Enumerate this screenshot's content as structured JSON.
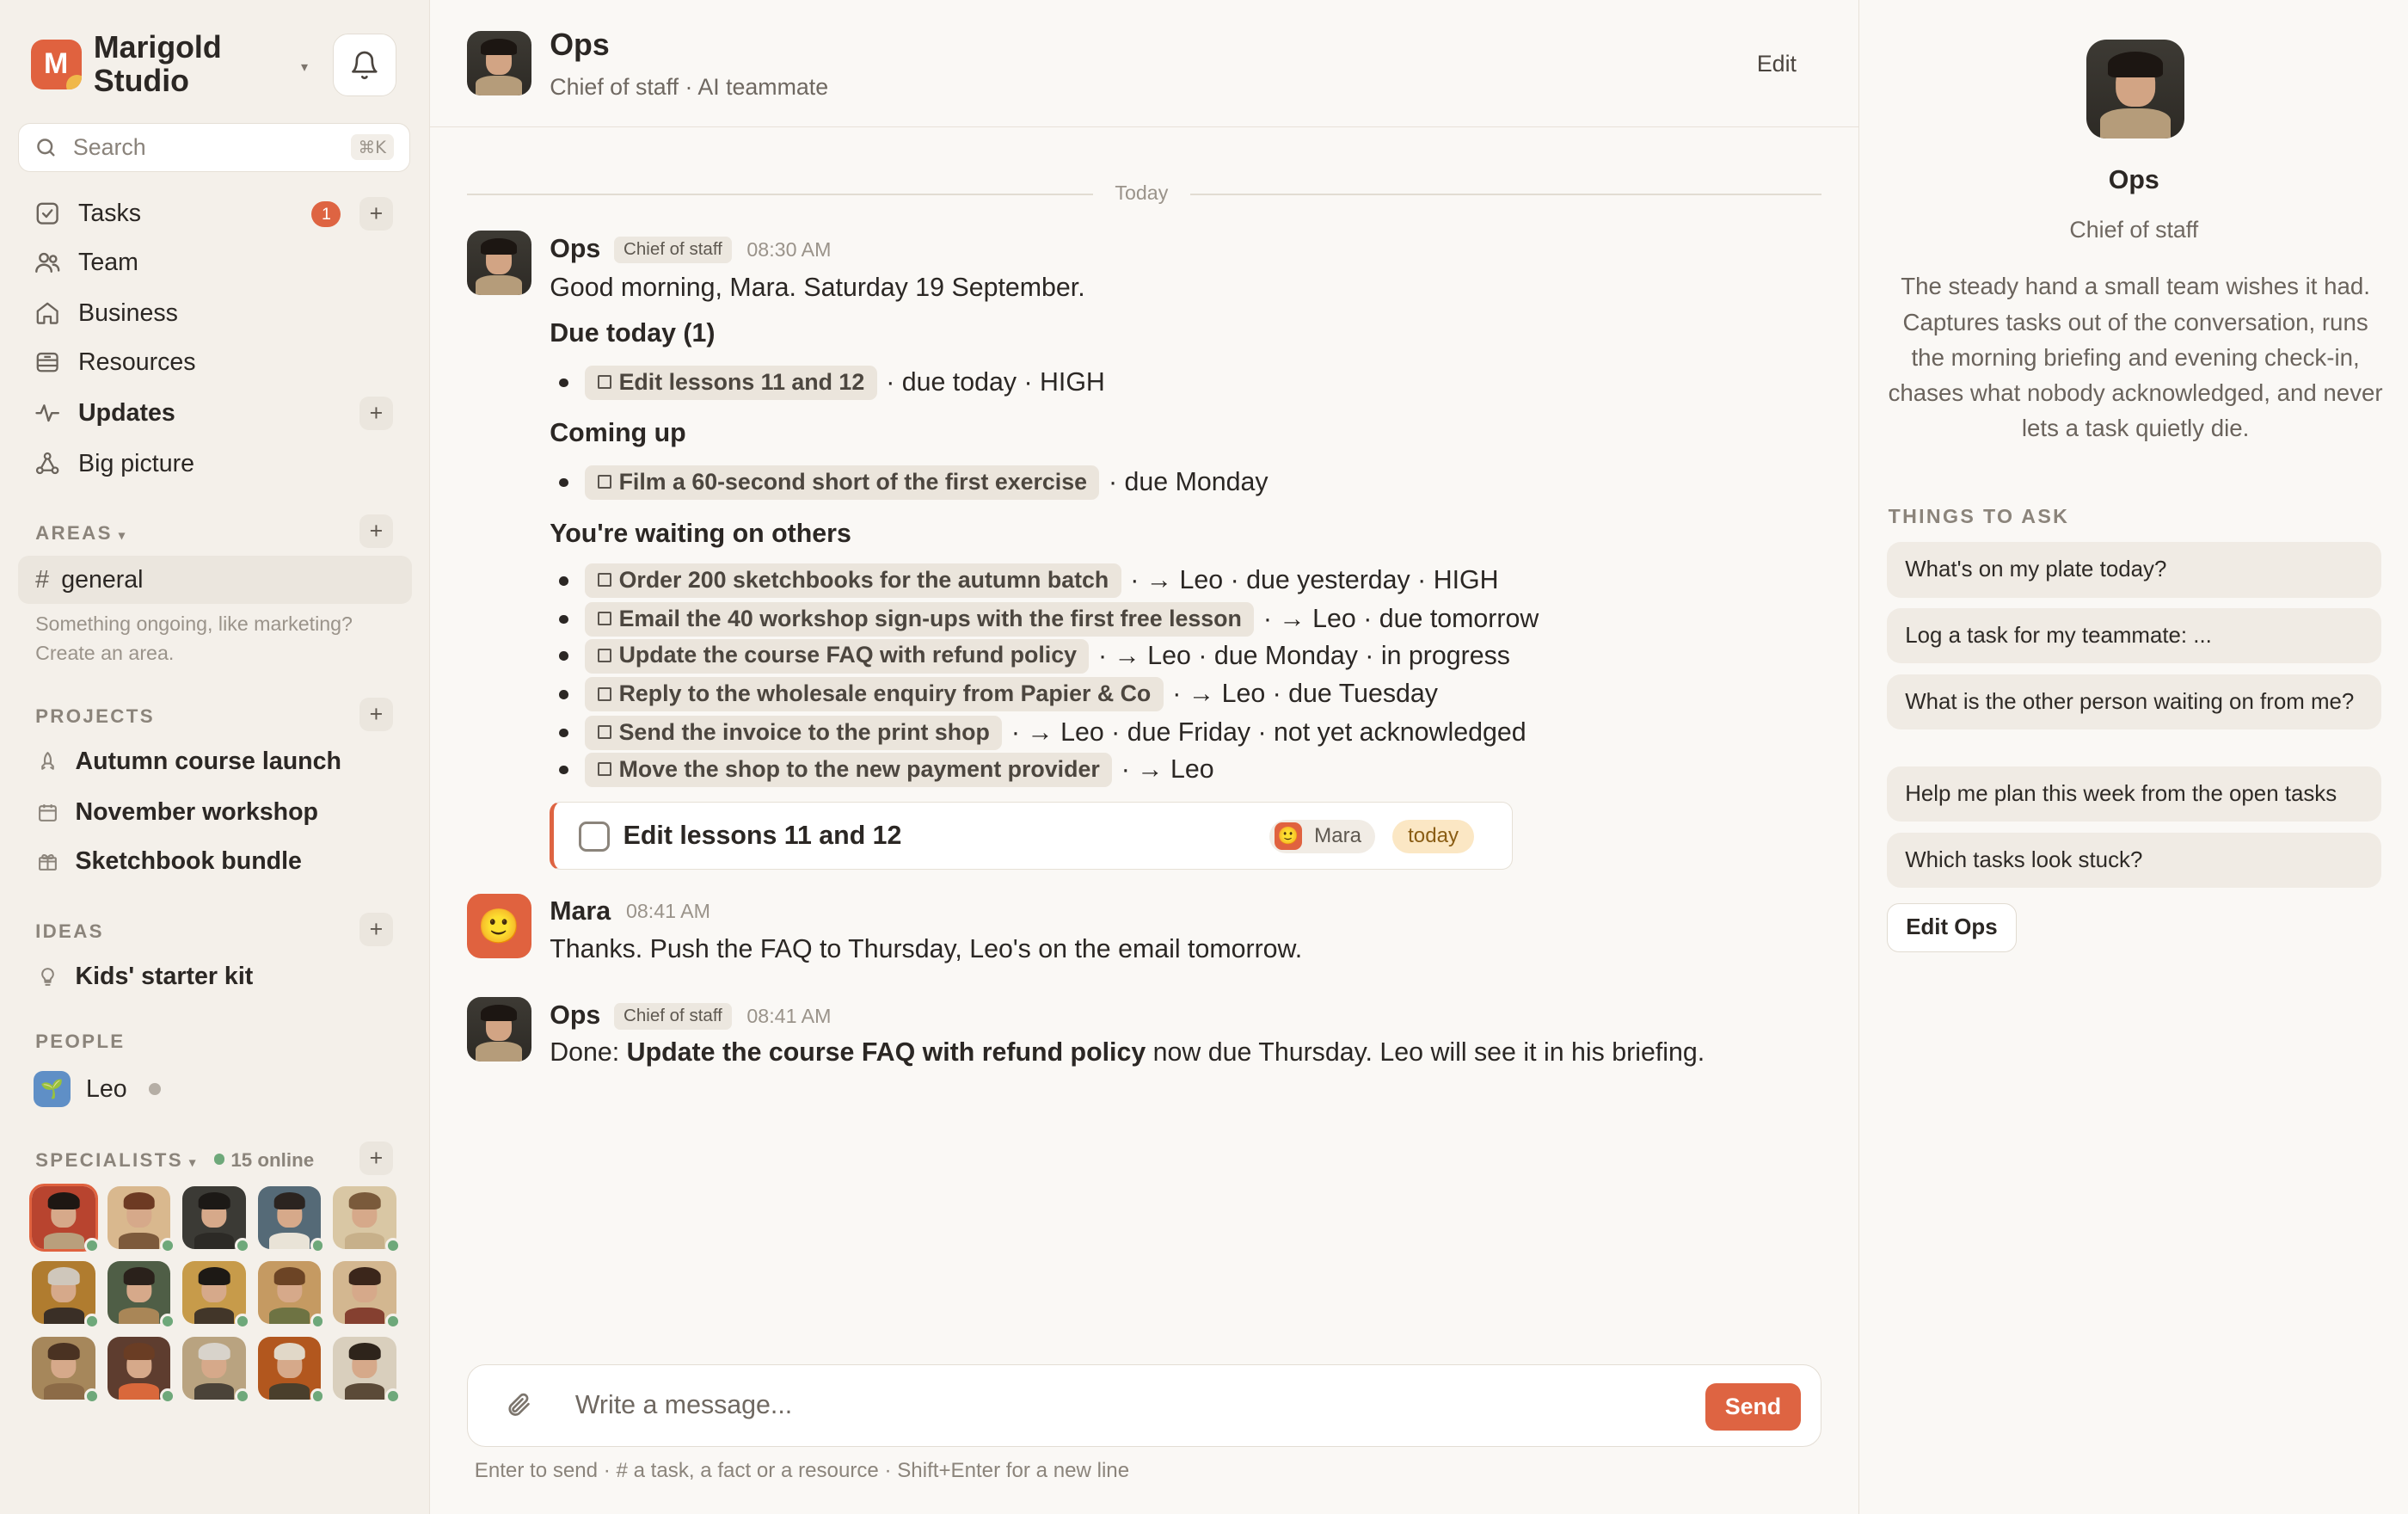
{
  "workspace": {
    "name": "Marigold Studio",
    "logo_letter": "M",
    "caret": "▾"
  },
  "search": {
    "placeholder": "Search",
    "shortcut": "⌘K"
  },
  "nav": [
    {
      "label": "Tasks",
      "icon": "checkbox-icon",
      "badge": "1",
      "plus": true
    },
    {
      "label": "Team",
      "icon": "team-icon"
    },
    {
      "label": "Business",
      "icon": "home-icon"
    },
    {
      "label": "Resources",
      "icon": "archive-icon"
    },
    {
      "label": "Updates",
      "icon": "activity-icon",
      "plus": true,
      "bold": true
    },
    {
      "label": "Big picture",
      "icon": "nodes-icon"
    }
  ],
  "areas": {
    "title": "AREAS",
    "items": [
      {
        "label": "general",
        "prefix": "#"
      }
    ],
    "hint": "Something ongoing, like marketing? Create an area."
  },
  "projects": {
    "title": "PROJECTS",
    "items": [
      {
        "label": "Autumn course launch",
        "icon": "rocket-icon"
      },
      {
        "label": "November workshop",
        "icon": "calendar-icon"
      },
      {
        "label": "Sketchbook bundle",
        "icon": "gift-icon"
      }
    ]
  },
  "ideas": {
    "title": "IDEAS",
    "items": [
      {
        "label": "Kids' starter kit",
        "icon": "lightbulb-icon"
      }
    ]
  },
  "people": {
    "title": "PEOPLE",
    "items": [
      {
        "label": "Leo",
        "avatar": "🌱"
      }
    ]
  },
  "specialists": {
    "title": "SPECIALISTS",
    "online": "15 online",
    "avatars": [
      {
        "bg": "#b8442f",
        "hair": "#1e1713",
        "shirt": "#b99f7c",
        "selected": true
      },
      {
        "bg": "#d9b88e",
        "hair": "#6d3a23",
        "shirt": "#7d5a3c"
      },
      {
        "bg": "#3b3a35",
        "hair": "#1c1916",
        "shirt": "#2c2a26"
      },
      {
        "bg": "#556a77",
        "hair": "#2b2420",
        "shirt": "#e9e3d7"
      },
      {
        "bg": "#d9c7a4",
        "hair": "#7a5a3b",
        "shirt": "#c7b08a"
      },
      {
        "bg": "#b07c2f",
        "hair": "#cfc7bb",
        "shirt": "#3a2f26"
      },
      {
        "bg": "#4f5e46",
        "hair": "#2a211b",
        "shirt": "#a98657"
      },
      {
        "bg": "#c79b4a",
        "hair": "#1d1915",
        "shirt": "#423629"
      },
      {
        "bg": "#c59a62",
        "hair": "#6c4425",
        "shirt": "#6e7343"
      },
      {
        "bg": "#d3b790",
        "hair": "#3b261b",
        "shirt": "#854030"
      },
      {
        "bg": "#a6875b",
        "hair": "#4a3222",
        "shirt": "#8c6b47"
      },
      {
        "bg": "#5e3d2f",
        "hair": "#6a3d24",
        "shirt": "#d9683b"
      },
      {
        "bg": "#b9a380",
        "hair": "#d8d3cb",
        "shirt": "#4b4339"
      },
      {
        "bg": "#b2571e",
        "hair": "#e1d8c8",
        "shirt": "#4a3f2c"
      },
      {
        "bg": "#d9cfbd",
        "hair": "#2e241b",
        "shirt": "#5b4a38"
      }
    ]
  },
  "header": {
    "name": "Ops",
    "subtitle": "Chief of staff · AI teammate",
    "edit": "Edit"
  },
  "thread": {
    "day": "Today",
    "msg1": {
      "name": "Ops",
      "role": "Chief of staff",
      "time": "08:30 AM",
      "greeting": "Good morning, Mara. Saturday 19 September.",
      "due_today_title": "Due today (1)",
      "due_today": [
        {
          "task": "Edit lessons 11 and 12",
          "after": "· due today · HIGH"
        }
      ],
      "coming_up_title": "Coming up",
      "coming_up": [
        {
          "task": "Film a 60-second short of the first exercise",
          "after": "· due Monday"
        }
      ],
      "waiting_title": "You're waiting on others",
      "waiting": [
        {
          "task": "Order 200 sketchbooks for the autumn batch",
          "after": "· → Leo · due yesterday · HIGH"
        },
        {
          "task": "Email the 40 workshop sign-ups with the first free lesson",
          "after": "· → Leo · due tomorrow"
        },
        {
          "task": "Update the course FAQ with refund policy",
          "after": "· → Leo · due Monday · in progress"
        },
        {
          "task": "Reply to the wholesale enquiry from Papier & Co",
          "after": "· → Leo · due Tuesday"
        },
        {
          "task": "Send the invoice to the print shop",
          "after": "· → Leo · due Friday · not yet acknowledged"
        },
        {
          "task": "Move the shop to the new payment provider",
          "after": "· → Leo"
        }
      ],
      "card": {
        "title": "Edit lessons 11 and 12",
        "assignee": "Mara",
        "due": "today"
      }
    },
    "msg2": {
      "name": "Mara",
      "time": "08:41 AM",
      "text": "Thanks. Push the FAQ to Thursday, Leo's on the email tomorrow."
    },
    "msg3": {
      "name": "Ops",
      "role": "Chief of staff",
      "time": "08:41 AM",
      "prefix": "Done: ",
      "bold": "Update the course FAQ with refund policy",
      "suffix": " now due Thursday. Leo will see it in his briefing."
    }
  },
  "composer": {
    "placeholder": "Write a message...",
    "send": "Send",
    "hint": "Enter to send · # a task, a fact or a resource · Shift+Enter for a new line"
  },
  "panel": {
    "name": "Ops",
    "role": "Chief of staff",
    "description": "The steady hand a small team wishes it had. Captures tasks out of the conversation, runs the morning briefing and evening check-in, chases what nobody acknowledged, and never lets a task quietly die.",
    "things_title": "THINGS TO ASK",
    "asks": [
      "What's on my plate today?",
      "Log a task for my teammate: ...",
      "What is the other person waiting on from me?",
      "Help me plan this week from the open tasks",
      "Which tasks look stuck?"
    ],
    "edit_button": "Edit Ops"
  },
  "colors": {
    "accent": "#de6442",
    "background": "#faf8f5",
    "sidebar": "#f4f0ea",
    "due_pill": "#fbe7c4",
    "online": "#6ea87a"
  }
}
